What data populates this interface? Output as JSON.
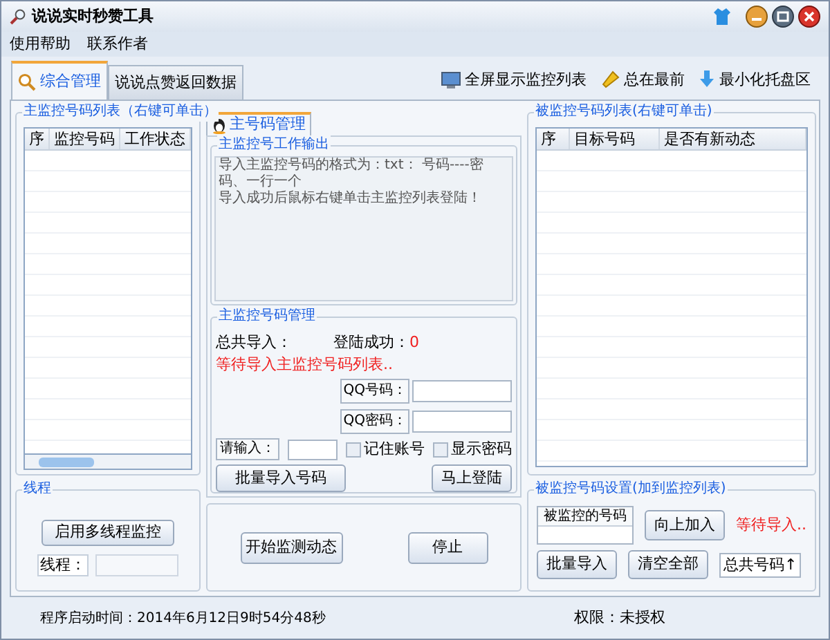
{
  "window": {
    "title": "说说实时秒赞工具"
  },
  "menu": [
    "使用帮助",
    "联系作者"
  ],
  "tabs": [
    {
      "label": "综合管理",
      "selected": true
    },
    {
      "label": "说说点赞返回数据",
      "selected": false
    }
  ],
  "toolbar": [
    {
      "kind": "screen",
      "label": "全屏显示监控列表"
    },
    {
      "kind": "pin",
      "label": "总在最前"
    },
    {
      "kind": "tray",
      "label": "最小化托盘区"
    }
  ],
  "main_list": {
    "title": "主监控号码列表（右键可单击）",
    "columns": [
      "序",
      "监控号码",
      "工作状态"
    ]
  },
  "inner_tab": {
    "label": "主号码管理",
    "selected": true
  },
  "output": {
    "title": "主监控号工作输出",
    "lines": [
      "导入主监控号码的格式为：txt： 号码----密码、一行一个",
      "导入成功后鼠标右键单击主监控列表登陆！"
    ]
  },
  "management": {
    "title": "主监控号码管理",
    "total_label": "总共导入：",
    "success_label": "登陆成功：",
    "success_count": "0",
    "status": "等待导入主监控号码列表..",
    "qq_label": "QQ号码：",
    "password_label": "QQ密码：",
    "input_label": "请输入：",
    "checkboxes": [
      {
        "label": "记住账号",
        "checked": false
      },
      {
        "label": "显示密码",
        "checked": false
      }
    ],
    "buttons": [
      "批量导入号码",
      "马上登陆"
    ]
  },
  "thread": {
    "title": "线程",
    "button": "启用多线程监控",
    "label": "线程："
  },
  "monitor_buttons": [
    "开始监测动态",
    "停止"
  ],
  "target_list": {
    "title": "被监控号码列表(右键可单击)",
    "columns": [
      "序",
      "目标号码",
      "是否有新动态"
    ]
  },
  "settings": {
    "title": "被监控号码设置(加到监控列表)",
    "field_label": "被监控的号码",
    "add_button": "向上加入",
    "status": "等待导入..",
    "import_button": "批量导入",
    "clear_button": "清空全部",
    "total_label": "总共号码↑"
  },
  "status_bar": {
    "start_time": "程序启动时间：2014年6月12日9时54分48秒",
    "permission": "权限：未授权"
  }
}
